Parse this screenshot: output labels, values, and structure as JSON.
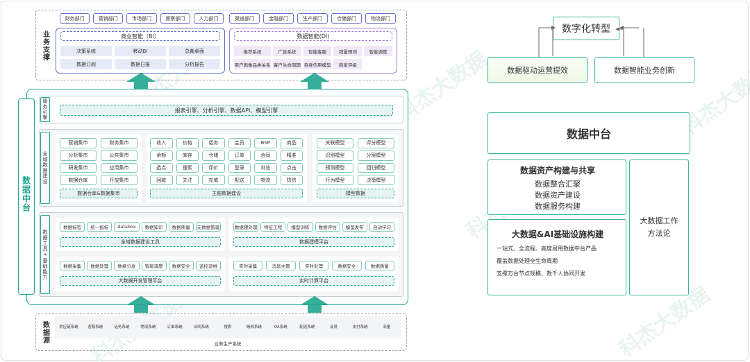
{
  "business_support": {
    "label": "业务支撑",
    "departments_left": [
      "财务部门",
      "营销部门",
      "市场部门",
      "督察部门",
      "人力部门"
    ],
    "departments_right": [
      "渠道部门",
      "金融部门",
      "生产部门",
      "仓储部门",
      "物流部门"
    ],
    "bi": {
      "title": "商业智能（BI）",
      "items": [
        "决策系统",
        "移动BI",
        "总裁桌面",
        "数据订阅",
        "数据日报",
        "分析报告"
      ]
    },
    "di": {
      "title": "数据智能(DI)",
      "items": [
        "推荐系统",
        "广告系统",
        "智能客服",
        "销量预测",
        "智能调度",
        "用户画像品类关系",
        "客户生命周期",
        "自身信用模型",
        "商家评级"
      ]
    }
  },
  "data_platform": {
    "label": "数据中台",
    "service_engine": {
      "label": "服务引擎",
      "content": "报表引擎、分析引擎、数据API、模型引擎"
    },
    "global_data": {
      "label": "全域数据建设",
      "warehouse": {
        "cells": [
          "营销集市",
          "财务集市",
          "分析集市",
          "公共集市",
          "研发集市",
          "应用集市",
          "数据仓库",
          "开放集市"
        ],
        "title": "数据仓库&数据集市"
      },
      "topic": {
        "cells": [
          "收入",
          "价格",
          "话务",
          "会员",
          "BSP",
          "商品",
          "余额",
          "库存",
          "仓储",
          "订单",
          "合同",
          "精准",
          "选点",
          "搜索",
          "评价",
          "登录",
          "浏览",
          "点击",
          "回款",
          "关注",
          "充值",
          "配送",
          "物流",
          "短信"
        ],
        "title": "主题数据建设"
      },
      "model": {
        "cells": [
          "关联模型",
          "评分模型",
          "识别模型",
          "分层模型",
          "预测模型",
          "回归模型",
          "行为模型",
          "决策模型"
        ],
        "title": "模型数据"
      }
    },
    "tools": {
      "label": "数据工具+基础能力",
      "row1_left": [
        "数据标签",
        "统一指标",
        "databox",
        "数据知识",
        "数据质量",
        "元数据管理"
      ],
      "row1_left_title": "全域数据建设工具",
      "row1_right": [
        "数据预处理",
        "特征工程",
        "模型训练",
        "数据评估",
        "模型发布",
        "自动学习"
      ],
      "row1_right_title": "数据建模平台",
      "row2_left": [
        "数据采集",
        "数据处理",
        "数据分发",
        "智能调度",
        "数据安全",
        "监控运维"
      ],
      "row2_left_title": "大数据开发管理平台",
      "row2_right": [
        "实时采集",
        "消息主题",
        "实时处理",
        "数据安全",
        "数据质量"
      ],
      "row2_right_title": "实时计算平台"
    }
  },
  "data_source": {
    "label": "数据源",
    "items": [
      "供应链系统",
      "客服系统",
      "话务系统",
      "物流系统",
      "订单系统",
      "合同系统",
      "搜索",
      "绩效系统",
      "OA系统",
      "配送系统",
      "会员",
      "支付系统",
      "流量"
    ],
    "footer": "业务生产系统"
  },
  "right_panel": {
    "top": "数字化转型",
    "left_goal": "数据驱动运营提效",
    "right_goal": "数据智能业务创新",
    "platform": "数据中台",
    "asset": {
      "title": "数据资产构建与共享",
      "lines": [
        "数据整合汇聚",
        "数据资产建设",
        "数据服务构建"
      ]
    },
    "infra": {
      "title": "大数据&AI基础设施构建",
      "lines": [
        "一站式、全流程、高度易用数据中台产品",
        "覆盖数据处理全生命周期",
        "支撑万台节点规模、数千人协同开发"
      ]
    },
    "methodology": "大数据工作方法论"
  },
  "watermark": {
    "text": "科杰大数据",
    "url": "www.kejiedata.com"
  },
  "colors": {
    "teal": "#1fa58f",
    "blue": "#5a6fc9",
    "purple": "#9f7dd1",
    "light_teal": "#e6f4f1"
  }
}
